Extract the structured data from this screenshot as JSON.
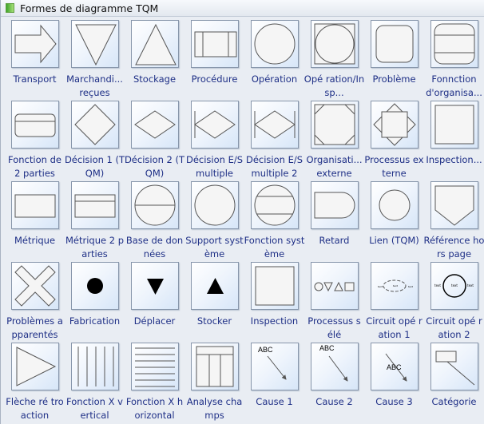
{
  "panel": {
    "title": "Formes de diagramme TQM",
    "accent": "#1e2f86"
  },
  "shapes": [
    {
      "label": "Transport",
      "icon": "arrow-right"
    },
    {
      "label": "Marchandi... reçues",
      "icon": "triangle-down"
    },
    {
      "label": "Stockage",
      "icon": "triangle-up"
    },
    {
      "label": "Procédure",
      "icon": "procedure"
    },
    {
      "label": "Opération",
      "icon": "circle"
    },
    {
      "label": "Opé ration/Insp...",
      "icon": "circle-in-square"
    },
    {
      "label": "Problème",
      "icon": "rounded-square"
    },
    {
      "label": "Fonnction d'organisa...",
      "icon": "org-function"
    },
    {
      "label": "Fonction de 2 parties",
      "icon": "two-part-function"
    },
    {
      "label": "Décision 1 (TQM)",
      "icon": "diamond"
    },
    {
      "label": "Décision 2 (TQM)",
      "icon": "flat-diamond"
    },
    {
      "label": "Décision E/S multiple",
      "icon": "diamond-bar"
    },
    {
      "label": "Décision E/S multiple 2",
      "icon": "diamond-two-bars"
    },
    {
      "label": "Organisati... externe",
      "icon": "octagon-square"
    },
    {
      "label": "Processus externe",
      "icon": "diamond-square"
    },
    {
      "label": "Inspection...",
      "icon": "square"
    },
    {
      "label": "Métrique",
      "icon": "rectangle"
    },
    {
      "label": "Métrique 2 parties",
      "icon": "rectangle-split"
    },
    {
      "label": "Base de données",
      "icon": "circle-split"
    },
    {
      "label": "Support système",
      "icon": "circle"
    },
    {
      "label": "Fonction système",
      "icon": "circle-two-lines"
    },
    {
      "label": "Retard",
      "icon": "delay"
    },
    {
      "label": "Lien (TQM)",
      "icon": "small-circle"
    },
    {
      "label": "Référence hors page",
      "icon": "off-page"
    },
    {
      "label": "Problèmes apparentés",
      "icon": "cross"
    },
    {
      "label": "Fabrication",
      "icon": "dot"
    },
    {
      "label": "Déplacer",
      "icon": "black-triangle-down"
    },
    {
      "label": "Stocker",
      "icon": "black-triangle-up"
    },
    {
      "label": "Inspection",
      "icon": "square"
    },
    {
      "label": "Processus s élé",
      "icon": "shapes-row"
    },
    {
      "label": "Circuit opé ration 1",
      "icon": "circuit-1"
    },
    {
      "label": "Circuit opé ration 2",
      "icon": "circuit-2"
    },
    {
      "label": "Flèche ré troaction",
      "icon": "triangle-right"
    },
    {
      "label": "Fonction X vertical",
      "icon": "vertical-lines"
    },
    {
      "label": "Fonction X horizontal",
      "icon": "horizontal-lines"
    },
    {
      "label": "Analyse champs",
      "icon": "field-analysis"
    },
    {
      "label": "Cause 1",
      "icon": "cause-1"
    },
    {
      "label": "Cause 2",
      "icon": "cause-2"
    },
    {
      "label": "Cause 3",
      "icon": "cause-3"
    },
    {
      "label": "Catégorie",
      "icon": "category"
    }
  ],
  "shape_text": {
    "abc": "ABC",
    "text": "text"
  }
}
